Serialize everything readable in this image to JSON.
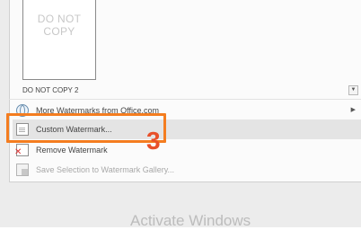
{
  "gallery": {
    "thumbnail_text": "DO NOT COPY",
    "caption": "DO NOT COPY 2"
  },
  "menu": {
    "items": [
      {
        "label": "More Watermarks from Office.com",
        "icon": "globe-icon",
        "has_submenu": true
      },
      {
        "label": "Custom Watermark...",
        "icon": "custom-watermark-icon"
      },
      {
        "label": "Remove Watermark",
        "icon": "remove-watermark-icon"
      },
      {
        "label": "Save Selection to Watermark Gallery...",
        "icon": "save-gallery-icon",
        "disabled": true
      }
    ],
    "submenu_glyph": "▶",
    "scroll_glyph": "▼"
  },
  "annotation": {
    "step": "3",
    "color": "#f47d20"
  },
  "overlay": {
    "activate_text": "Activate Windows"
  }
}
